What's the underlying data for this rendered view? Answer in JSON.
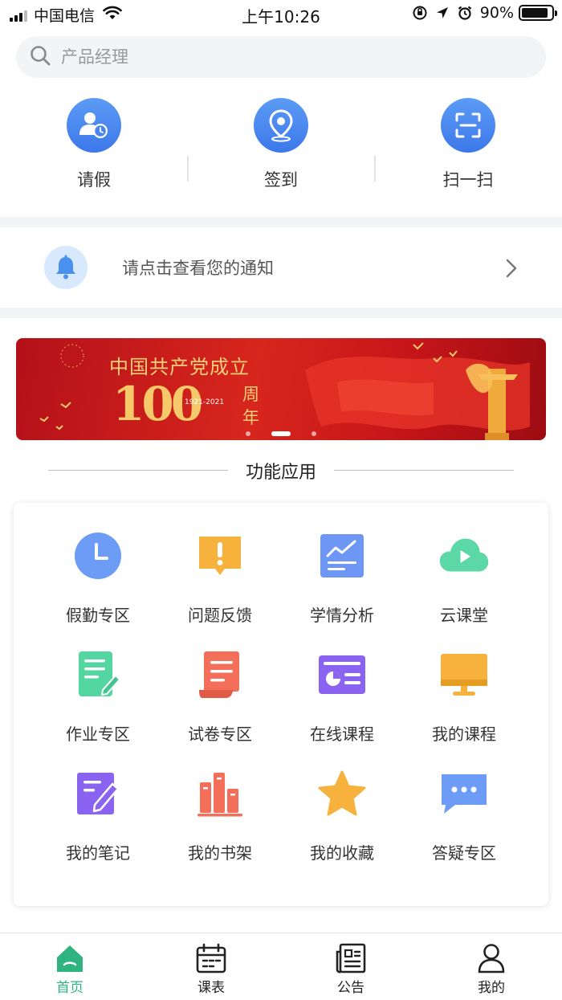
{
  "status_bar": {
    "carrier": "中国电信",
    "time": "上午10:26",
    "battery": "90%",
    "battery_level": 0.9
  },
  "search": {
    "placeholder": "产品经理",
    "icon": "search-icon"
  },
  "quick_actions": [
    {
      "label": "请假",
      "icon": "user-clock-icon"
    },
    {
      "label": "签到",
      "icon": "location-pin-icon"
    },
    {
      "label": "扫一扫",
      "icon": "scan-icon"
    }
  ],
  "notice": {
    "text": "请点击查看您的通知",
    "icon": "bell-icon"
  },
  "banner": {
    "title": "中国共产党成立",
    "number": "100",
    "years": "1921-2021",
    "suffix": "周年",
    "slide_count": 3,
    "active_slide": 2
  },
  "section": {
    "title": "功能应用"
  },
  "apps": [
    {
      "label": "假勤专区",
      "icon": "clock-icon",
      "color": "#6d9cf7"
    },
    {
      "label": "问题反馈",
      "icon": "feedback-icon",
      "color": "#f6b23d"
    },
    {
      "label": "学情分析",
      "icon": "chart-icon",
      "color": "#6d96f5"
    },
    {
      "label": "云课堂",
      "icon": "cloud-play-icon",
      "color": "#5bd8a5"
    },
    {
      "label": "作业专区",
      "icon": "homework-icon",
      "color": "#54d6a0"
    },
    {
      "label": "试卷专区",
      "icon": "exam-scroll-icon",
      "color": "#f36f5a"
    },
    {
      "label": "在线课程",
      "icon": "online-course-icon",
      "color": "#8a63f0"
    },
    {
      "label": "我的课程",
      "icon": "monitor-icon",
      "color": "#f6b23d"
    },
    {
      "label": "我的笔记",
      "icon": "note-icon",
      "color": "#8a63f0"
    },
    {
      "label": "我的书架",
      "icon": "bookshelf-icon",
      "color": "#f36f5a"
    },
    {
      "label": "我的收藏",
      "icon": "star-icon",
      "color": "#f6b23d"
    },
    {
      "label": "答疑专区",
      "icon": "chat-icon",
      "color": "#6d9cf7"
    }
  ],
  "tabbar": [
    {
      "label": "首页",
      "icon": "home-icon",
      "active": true
    },
    {
      "label": "课表",
      "icon": "calendar-icon",
      "active": false
    },
    {
      "label": "公告",
      "icon": "news-icon",
      "active": false
    },
    {
      "label": "我的",
      "icon": "user-icon",
      "active": false
    }
  ],
  "colors": {
    "primary": "#4a86ee",
    "tab_active": "#2fb47f"
  }
}
